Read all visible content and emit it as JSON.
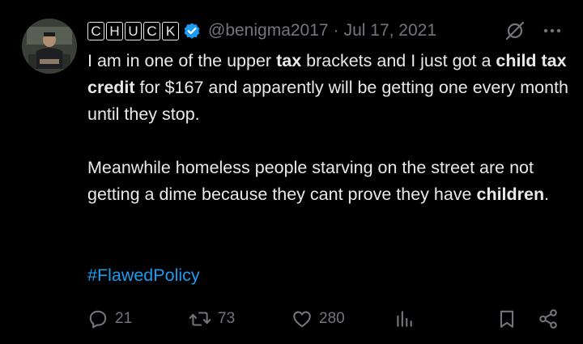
{
  "author": {
    "name_letters": [
      "C",
      "H",
      "U",
      "C",
      "K"
    ],
    "handle": "@benigma2017",
    "separator": "·",
    "date": "Jul 17, 2021"
  },
  "header_icons": {
    "grok": "grok-icon",
    "more": "more-icon"
  },
  "tweet": {
    "p1": {
      "t1": "I am in one of the upper ",
      "b1": "tax",
      "t2": " brackets and I just got a ",
      "b2": "child tax credit",
      "t3": " for $167 and apparently will be getting one every month until they stop."
    },
    "p2": {
      "t1": "Meanwhile homeless people starving on the street are not getting a dime because they cant prove they have ",
      "b1": "children",
      "t2": "."
    },
    "hashtag": "#FlawedPolicy"
  },
  "actions": {
    "replies": "21",
    "retweets": "73",
    "likes": "280",
    "icons": [
      "reply-icon",
      "retweet-icon",
      "like-icon",
      "views-icon",
      "bookmark-icon",
      "share-icon"
    ]
  },
  "colors": {
    "background": "#000000",
    "text": "#e7e9ea",
    "muted": "#71767b",
    "link": "#1d9bf0",
    "verified": "#1d9bf0"
  }
}
